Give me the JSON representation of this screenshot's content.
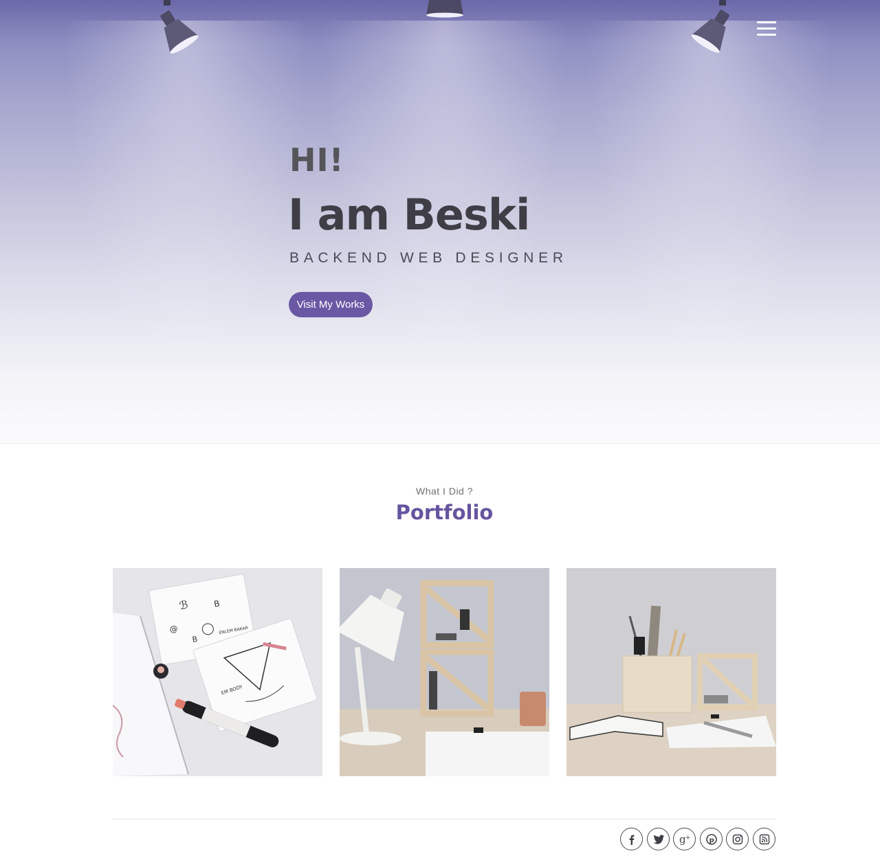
{
  "hero": {
    "greeting": "HI!",
    "name": "I am Beski",
    "role": "BACKEND WEB DESIGNER",
    "cta_label": "Visit My Works"
  },
  "nav": {
    "menu_icon": "hamburger-menu-icon"
  },
  "portfolio": {
    "kicker": "What I Did ?",
    "title": "Portfolio",
    "items": [
      {
        "subject": "stickers, sketches and marker on desk"
      },
      {
        "subject": "white desk lamp and stacked wooden shelf boxes"
      },
      {
        "subject": "wooden pen holder box with ruler and notebooks"
      }
    ]
  },
  "footer": {
    "social_icons": [
      "facebook-icon",
      "twitter-icon",
      "google-plus-icon",
      "pinterest-icon",
      "instagram-icon",
      "rss-icon"
    ]
  },
  "colors": {
    "accent": "#6a58a4",
    "title_purple": "#65559f",
    "hero_top": "#6b68a9",
    "dark_text": "#3f3e46"
  }
}
